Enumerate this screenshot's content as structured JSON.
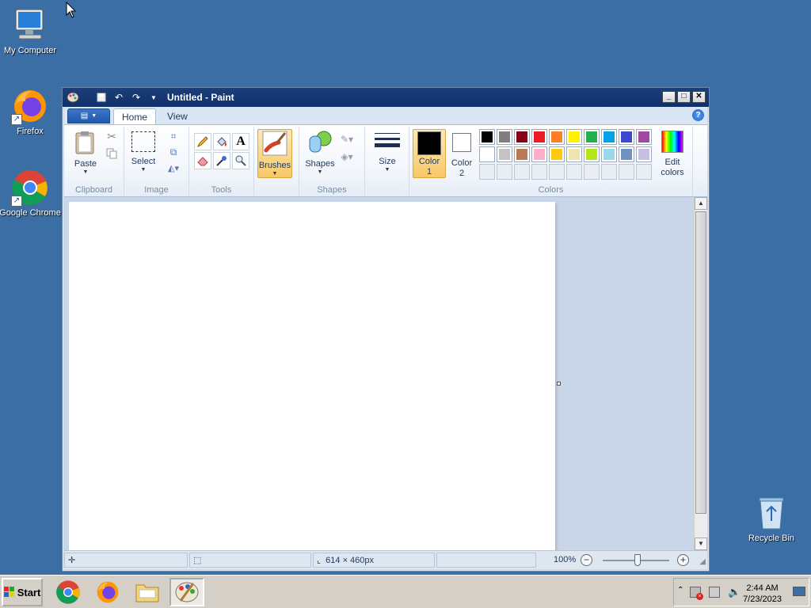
{
  "desktop": {
    "icons": [
      {
        "label": "My Computer"
      },
      {
        "label": "Firefox"
      },
      {
        "label": "Google Chrome"
      },
      {
        "label": "Recycle Bin"
      }
    ]
  },
  "window": {
    "title": "Untitled - Paint",
    "tabs": {
      "home": "Home",
      "view": "View"
    },
    "controls": {
      "minimize": "_",
      "maximize": "□",
      "close": "✕"
    }
  },
  "ribbon": {
    "clipboard": {
      "paste": "Paste",
      "group": "Clipboard"
    },
    "image": {
      "select": "Select",
      "group": "Image"
    },
    "tools": {
      "group": "Tools"
    },
    "brushes": {
      "label": "Brushes"
    },
    "shapes": {
      "label": "Shapes",
      "group": "Shapes"
    },
    "size": {
      "label": "Size"
    },
    "color1": {
      "line1": "Color",
      "line2": "1",
      "value": "#000000"
    },
    "color2": {
      "line1": "Color",
      "line2": "2",
      "value": "#ffffff"
    },
    "colors_group": "Colors",
    "edit_colors": {
      "line1": "Edit",
      "line2": "colors"
    },
    "palette_row1": [
      "#000000",
      "#7f7f7f",
      "#880015",
      "#ed1c24",
      "#ff7f27",
      "#fff200",
      "#22b14c",
      "#00a2e8",
      "#3f48cc",
      "#a349a4"
    ],
    "palette_row2": [
      "#ffffff",
      "#c3c3c3",
      "#b97a57",
      "#ffaec9",
      "#ffc90e",
      "#efe4b0",
      "#b5e61d",
      "#99d9ea",
      "#7092be",
      "#c8bfe7"
    ]
  },
  "statusbar": {
    "canvas_size": "614 × 460px",
    "zoom": "100%"
  },
  "taskbar": {
    "start": "Start",
    "time": "2:44 AM",
    "date": "7/23/2023"
  }
}
